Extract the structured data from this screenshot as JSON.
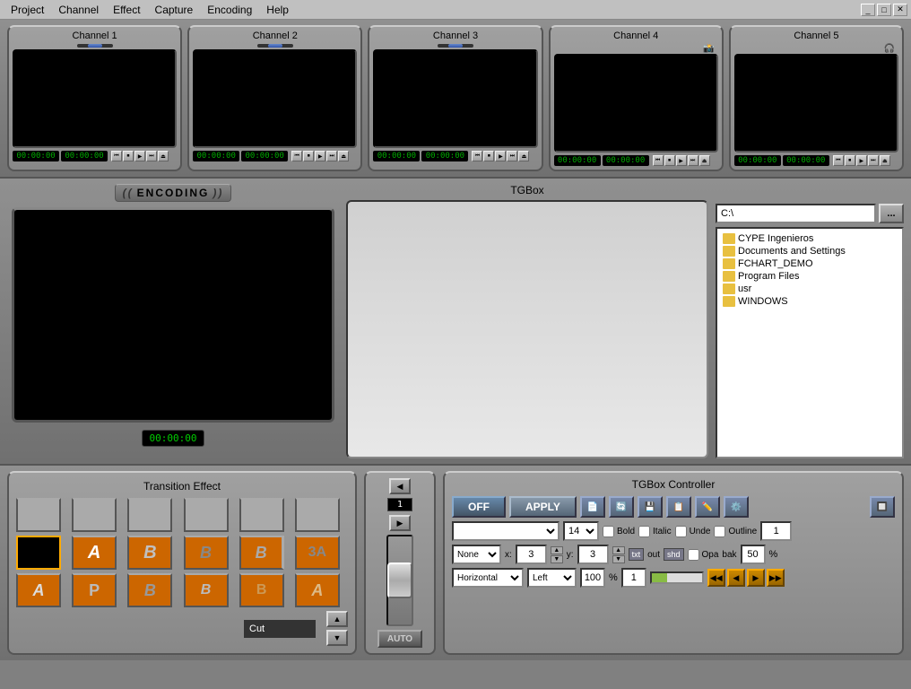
{
  "menubar": {
    "items": [
      "Project",
      "Channel",
      "Effect",
      "Capture",
      "Encoding",
      "Help"
    ]
  },
  "window_controls": {
    "minimize": "_",
    "maximize": "□",
    "close": "✕"
  },
  "channels": [
    {
      "id": "Channel 1",
      "timecode1": "00:00:00",
      "timecode2": "00:00:00"
    },
    {
      "id": "Channel 2",
      "timecode1": "00:00:00",
      "timecode2": "00:00:00"
    },
    {
      "id": "Channel 3",
      "timecode1": "00:00:00",
      "timecode2": "00:00:00"
    },
    {
      "id": "Channel 4",
      "timecode1": "00:00:00",
      "timecode2": "00:00:00"
    },
    {
      "id": "Channel 5",
      "timecode1": "00:00:00",
      "timecode2": "00:00:00"
    }
  ],
  "encoding": {
    "label": "ENCODING",
    "timecode": "00:00:00"
  },
  "tgbox": {
    "title": "TGBox",
    "path": "C:\\",
    "browse_label": "...",
    "files": [
      "CYPE Ingenieros",
      "Documents and Settings",
      "FCHART_DEMO",
      "Program Files",
      "usr",
      "WINDOWS"
    ]
  },
  "transition": {
    "title": "Transition Effect",
    "effect_name": "Cut",
    "slider_value": "1"
  },
  "tgbox_controller": {
    "title": "TGBox Controller",
    "off_label": "OFF",
    "apply_label": "APPLY",
    "font_placeholder": "",
    "font_size": "14",
    "bold_label": "Bold",
    "italic_label": "Italic",
    "underline_label": "Unde",
    "outline_label": "Outline",
    "none_label": "None",
    "x_label": "x:",
    "x_value": "3",
    "y_label": "y:",
    "y_value": "3",
    "txt_label": "txt",
    "out_label": "out",
    "shd_label": "shd",
    "opaque_label": "Opa",
    "back_label": "bak",
    "opacity_value": "50",
    "pct": "%",
    "direction_label": "Horizontal",
    "align_label": "Left",
    "zoom_value": "100",
    "zoom_pct": "%",
    "page_num": "1",
    "auto_label": "AUTO"
  }
}
